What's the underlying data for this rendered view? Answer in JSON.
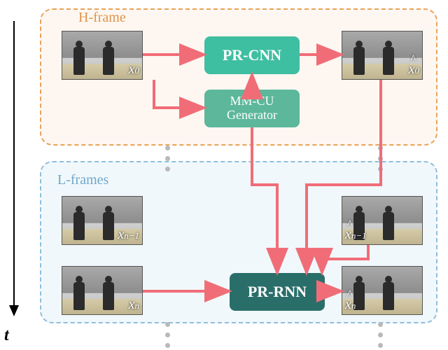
{
  "diagram": {
    "time_axis_label": "t",
    "regions": {
      "h": {
        "title": "H-frame"
      },
      "l": {
        "title": "L-frames"
      }
    },
    "blocks": {
      "pr_cnn": "PR-CNN",
      "mm_cu": "MM-CU\nGenerator",
      "pr_rnn": "PR-RNN"
    },
    "frames": {
      "x0": "x",
      "x0_sub": "0",
      "x0h": "x",
      "x0h_sub": "0",
      "xnm1": "x",
      "xnm1_sub": "n−1",
      "xnm1h": "x",
      "xnm1h_sub": "n−1",
      "xn": "x",
      "xn_sub": "n",
      "xnh": "x",
      "xnh_sub": "n"
    }
  }
}
